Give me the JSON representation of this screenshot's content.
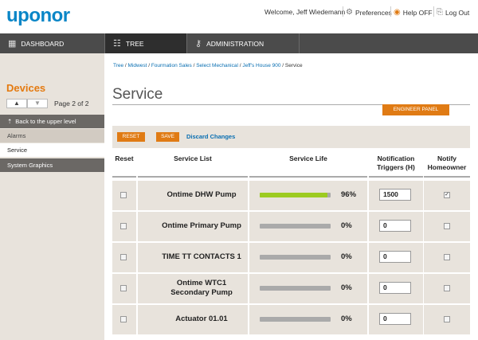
{
  "brand": {
    "logo_text": "uponor",
    "accent": "#0a86c7",
    "orange": "#e07b14"
  },
  "header": {
    "welcome": "Welcome, Jeff Wiedemann",
    "preferences": "Preferences",
    "help": "Help OFF",
    "logout": "Log Out"
  },
  "nav": {
    "dashboard": "DASHBOARD",
    "tree": "TREE",
    "administration": "ADMINISTRATION"
  },
  "sidebar": {
    "title": "Devices",
    "pager_text": "Page 2 of 2",
    "back_label": "Back to the upper level",
    "items": [
      "Alarms",
      "Service",
      "System Graphics"
    ],
    "selected": "Service"
  },
  "breadcrumb": {
    "links": [
      "Tree",
      "Midwest",
      "Fourmation Sales",
      "Select Mechanical",
      "Jeff's House 900"
    ],
    "current": "Service"
  },
  "page": {
    "title": "Service",
    "engineer_panel": "ENGINEER PANEL",
    "reset": "RESET",
    "save": "SAVE",
    "discard": "Discard Changes"
  },
  "table": {
    "headers": {
      "reset": "Reset",
      "service_list": "Service List",
      "service_life": "Service Life",
      "notification_1": "Notification",
      "notification_2": "Triggers (H)",
      "notify_1": "Notify",
      "notify_2": "Homeowner"
    },
    "rows": [
      {
        "name_1": "Ontime DHW Pump",
        "name_2": "",
        "life": 96,
        "life_text": "96%",
        "trigger": "1500",
        "notify": true
      },
      {
        "name_1": "Ontime Primary Pump",
        "name_2": "",
        "life": 0,
        "life_text": "0%",
        "trigger": "0",
        "notify": false
      },
      {
        "name_1": "TIME TT CONTACTS 1",
        "name_2": "",
        "life": 0,
        "life_text": "0%",
        "trigger": "0",
        "notify": false
      },
      {
        "name_1": "Ontime WTC1",
        "name_2": "Secondary Pump",
        "life": 0,
        "life_text": "0%",
        "trigger": "0",
        "notify": false
      },
      {
        "name_1": "Actuator 01.01",
        "name_2": "",
        "life": 0,
        "life_text": "0%",
        "trigger": "0",
        "notify": false
      }
    ]
  }
}
